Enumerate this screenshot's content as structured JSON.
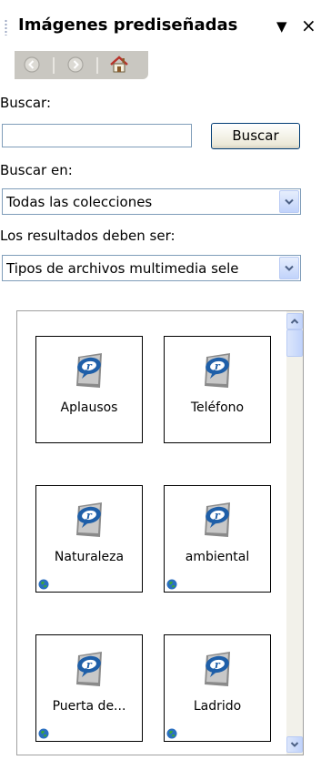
{
  "pane": {
    "title": "Imágenes prediseñadas",
    "menu_glyph": "▼",
    "close_glyph": "×"
  },
  "search": {
    "label": "Buscar:",
    "input_value": "",
    "button_label": "Buscar"
  },
  "search_in": {
    "label": "Buscar en:",
    "selected": "Todas las colecciones"
  },
  "results_type": {
    "label": "Los resultados deben ser:",
    "selected": "Tipos de archivos multimedia sele"
  },
  "results": [
    {
      "label": "Aplausos",
      "globe": false
    },
    {
      "label": "Teléfono",
      "globe": false
    },
    {
      "label": "Naturaleza",
      "globe": true
    },
    {
      "label": "ambiental",
      "globe": true
    },
    {
      "label": "Puerta de...",
      "globe": true
    },
    {
      "label": "Ladrido",
      "globe": true
    }
  ],
  "icons": {
    "back": "back-arrow-icon",
    "forward": "forward-arrow-icon",
    "home": "home-icon",
    "clip": "realmedia-clip-icon",
    "globe": "globe-icon"
  },
  "colors": {
    "toolbar": "#c9c7c1",
    "input_border": "#7f9db9",
    "scroll_button": "#c1d3fb",
    "clip_blue": "#1f5fa8"
  }
}
